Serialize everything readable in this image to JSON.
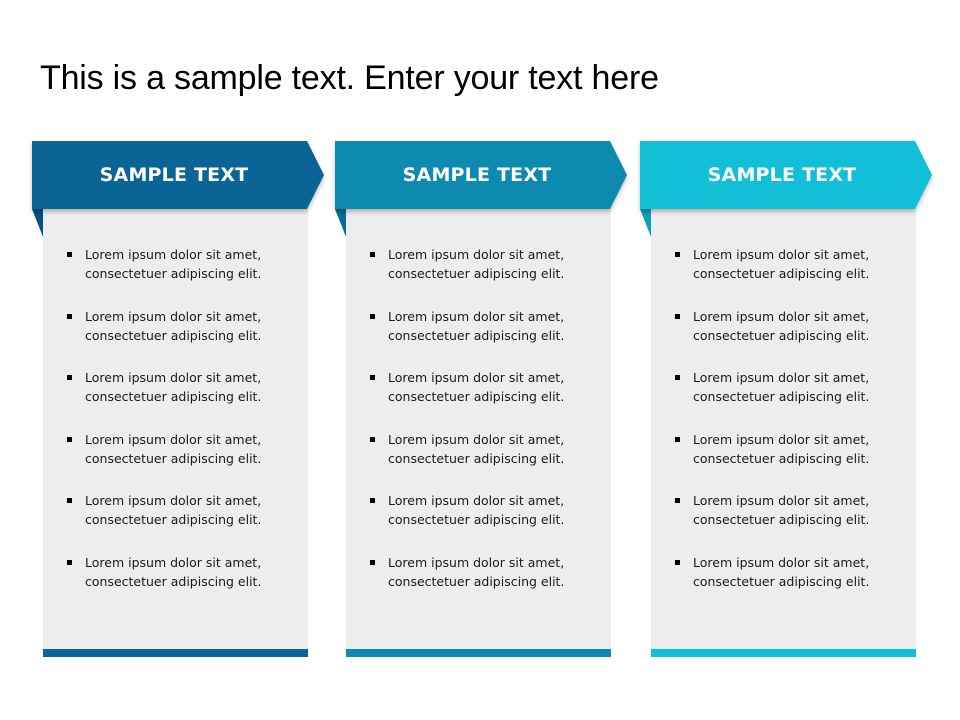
{
  "title": "This is a sample text. Enter your text here",
  "columns": [
    {
      "header": "SAMPLE TEXT",
      "color": "#0A6496",
      "fold_color": "#07507A",
      "items": [
        {
          "line1": "Lorem ipsum dolor sit amet,",
          "line2": "consectetuer adipiscing elit."
        },
        {
          "line1": "Lorem ipsum dolor sit amet,",
          "line2": "consectetuer adipiscing elit."
        },
        {
          "line1": "Lorem ipsum dolor sit amet,",
          "line2": "consectetuer adipiscing elit."
        },
        {
          "line1": "Lorem ipsum dolor sit amet,",
          "line2": "consectetuer adipiscing elit."
        },
        {
          "line1": "Lorem ipsum dolor sit amet,",
          "line2": "consectetuer adipiscing elit."
        },
        {
          "line1": "Lorem ipsum dolor sit amet,",
          "line2": "consectetuer adipiscing elit."
        }
      ]
    },
    {
      "header": "SAMPLE TEXT",
      "color": "#0E8AB0",
      "fold_color": "#0A6E8E",
      "items": [
        {
          "line1": "Lorem ipsum dolor sit amet,",
          "line2": "consectetuer adipiscing elit."
        },
        {
          "line1": "Lorem ipsum dolor sit amet,",
          "line2": "consectetuer adipiscing elit."
        },
        {
          "line1": "Lorem ipsum dolor sit amet,",
          "line2": "consectetuer adipiscing elit."
        },
        {
          "line1": "Lorem ipsum dolor sit amet,",
          "line2": "consectetuer adipiscing elit."
        },
        {
          "line1": "Lorem ipsum dolor sit amet,",
          "line2": "consectetuer adipiscing elit."
        },
        {
          "line1": "Lorem ipsum dolor sit amet,",
          "line2": "consectetuer adipiscing elit."
        }
      ]
    },
    {
      "header": "SAMPLE TEXT",
      "color": "#13BFD6",
      "fold_color": "#0E9FB3",
      "items": [
        {
          "line1": "Lorem ipsum dolor sit amet,",
          "line2": "consectetuer adipiscing elit."
        },
        {
          "line1": "Lorem ipsum dolor sit amet,",
          "line2": "consectetuer adipiscing elit."
        },
        {
          "line1": "Lorem ipsum dolor sit amet,",
          "line2": "consectetuer adipiscing elit."
        },
        {
          "line1": "Lorem ipsum dolor sit amet,",
          "line2": "consectetuer adipiscing elit."
        },
        {
          "line1": "Lorem ipsum dolor sit amet,",
          "line2": "consectetuer adipiscing elit."
        },
        {
          "line1": "Lorem ipsum dolor sit amet,",
          "line2": "consectetuer adipiscing elit."
        }
      ]
    }
  ]
}
